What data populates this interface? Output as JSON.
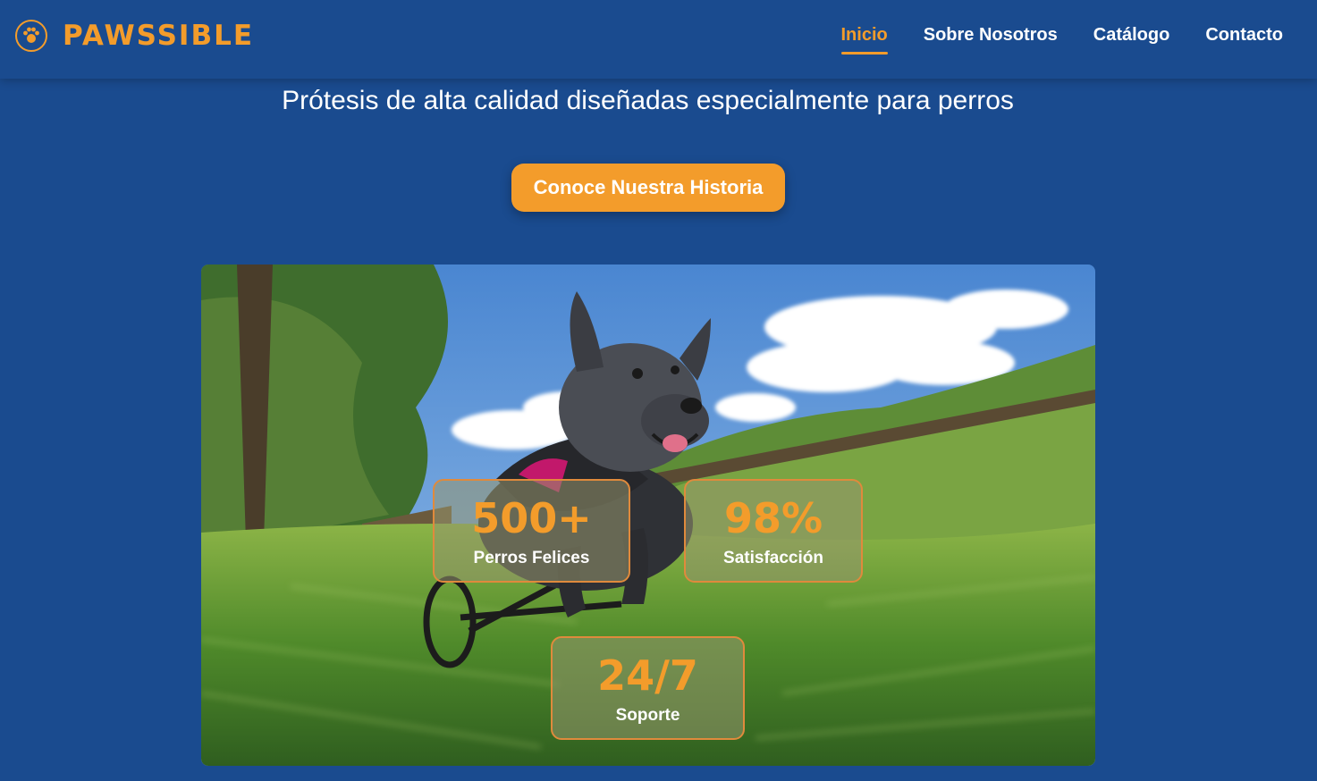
{
  "brand": {
    "name": "PAWSSIBLE",
    "logo_icon": "paw-badge-icon"
  },
  "nav": {
    "items": [
      {
        "label": "Inicio",
        "active": true
      },
      {
        "label": "Sobre Nosotros",
        "active": false
      },
      {
        "label": "Catálogo",
        "active": false
      },
      {
        "label": "Contacto",
        "active": false
      }
    ]
  },
  "hero": {
    "subtitle": "Prótesis de alta calidad diseñadas especialmente para perros",
    "cta_label": "Conoce Nuestra Historia",
    "image_icon": "dog-wheelchair-photo",
    "stats": [
      {
        "value": "500+",
        "label": "Perros Felices"
      },
      {
        "value": "98%",
        "label": "Satisfacción"
      },
      {
        "value": "24/7",
        "label": "Soporte"
      }
    ]
  },
  "colors": {
    "background": "#1a4b8f",
    "accent": "#f39c2b",
    "text": "#ffffff"
  }
}
